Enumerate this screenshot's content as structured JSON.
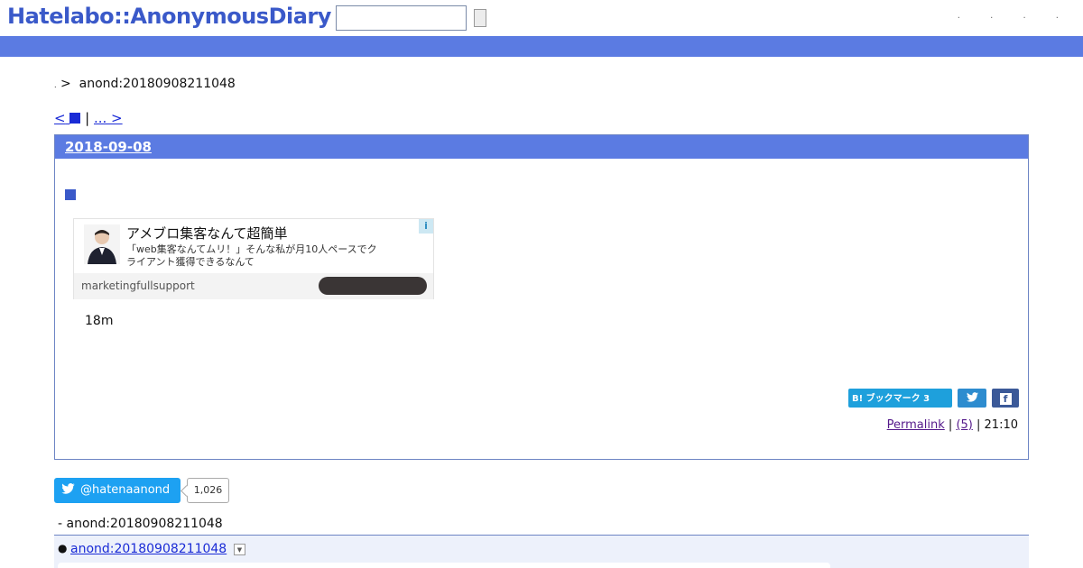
{
  "header": {
    "logo": "Hatelabo::AnonymousDiary",
    "search_value": "",
    "top_links": ". . . ."
  },
  "breadcrumb": {
    "dot": ".",
    "sep": ">",
    "current": "anond:20180908211048"
  },
  "pager": {
    "prev_label": "<",
    "separator": "|",
    "next_label": "... >"
  },
  "day": {
    "date": "2018-09-08",
    "ad": {
      "title": "アメブロ集客なんて超簡単",
      "description": "「web集客なんてムリ！」そんな私が月10人ペースでクライアント獲得できるなんて",
      "source": "marketingfullsupport",
      "info_icon": "i"
    },
    "body_text": "18m",
    "share": {
      "hatena_label": "B! ブックマーク 3",
      "twitter_icon": "twitter-icon",
      "facebook_icon": "f"
    },
    "footer": {
      "permalink": "Permalink",
      "sep1": "|",
      "comments": "(5)",
      "sep2": "|",
      "time": "21:10"
    }
  },
  "follow": {
    "label": "@hatenaanond",
    "count": "1,026"
  },
  "refs": {
    "title": "-  anond:20180908211048",
    "items": [
      {
        "label": "anond:20180908211048"
      }
    ]
  },
  "colors": {
    "accent": "#5b7be2",
    "logo": "#3a59c9",
    "link": "#1a2bd6",
    "twitter": "#1da1f2"
  }
}
